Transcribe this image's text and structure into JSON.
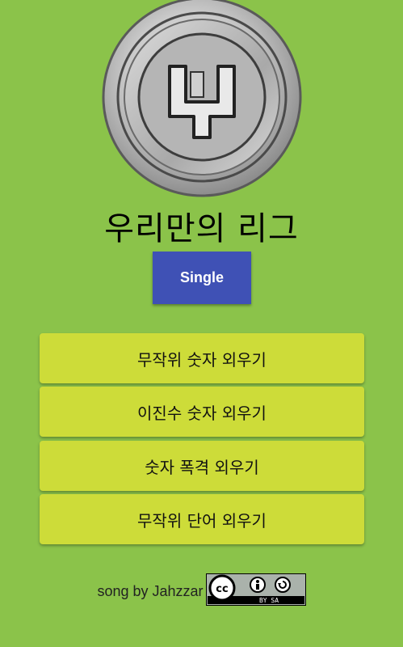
{
  "app": {
    "title": "우리만의 리그"
  },
  "mode_button": {
    "label": "Single"
  },
  "menu": [
    {
      "label": "무작위 숫자 외우기"
    },
    {
      "label": "이진수 숫자 외우기"
    },
    {
      "label": "숫자 폭격 외우기"
    },
    {
      "label": "무작위 단어 외우기"
    }
  ],
  "footer": {
    "credit": "song by Jahzzar",
    "license_badge": {
      "icon": "cc-by-sa-icon",
      "label": "BY SA"
    }
  },
  "colors": {
    "background": "#8bc34a",
    "mode_button": "#3f51b5",
    "menu_button": "#cddc39"
  }
}
